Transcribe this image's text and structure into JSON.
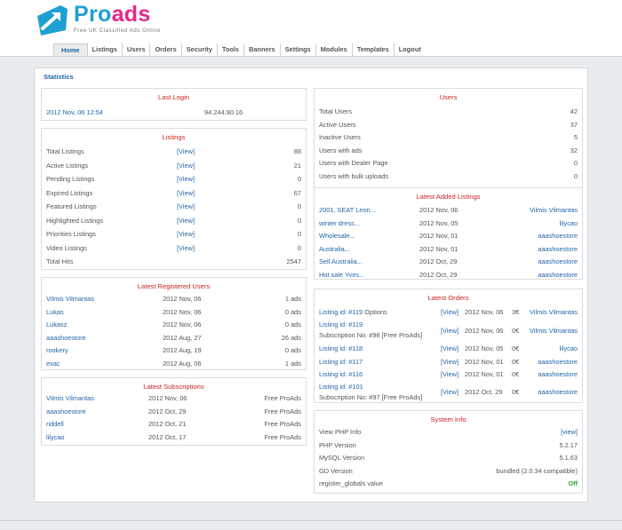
{
  "brand": {
    "name_part1": "Pro",
    "name_part2": "ads",
    "tagline": "Free UK Classified Ads Online"
  },
  "nav": [
    "Home",
    "Listings",
    "Users",
    "Orders",
    "Security",
    "Tools",
    "Banners",
    "Settings",
    "Modules",
    "Templates",
    "Logout"
  ],
  "page_title": "Statistics",
  "last_login": {
    "title": "Last Login",
    "date": "2012 Nov, 06 12:54",
    "ip": "94.244.90.16"
  },
  "listings": {
    "title": "Listings",
    "rows": [
      {
        "label": "Total Listings",
        "link": "[View]",
        "value": "88"
      },
      {
        "label": "Active Listings",
        "link": "[View]",
        "value": "21"
      },
      {
        "label": "Pending Listings",
        "link": "[View]",
        "value": "0"
      },
      {
        "label": "Expired Listings",
        "link": "[View]",
        "value": "67"
      },
      {
        "label": "Featured Listings",
        "link": "[View]",
        "value": "0"
      },
      {
        "label": "Highlighted Listings",
        "link": "[View]",
        "value": "0"
      },
      {
        "label": "Priorities Listings",
        "link": "[View]",
        "value": "0"
      },
      {
        "label": "Video Listings",
        "link": "[View]",
        "value": "0"
      }
    ],
    "total_hits_label": "Total Hits",
    "total_hits": "2547"
  },
  "latest_users": {
    "title": "Latest Registered Users",
    "rows": [
      {
        "name": "Vilmis Vilmantas",
        "date": "2012 Nov, 06",
        "ads": "1 ads"
      },
      {
        "name": "Lukas",
        "date": "2012 Nov, 06",
        "ads": "0 ads"
      },
      {
        "name": "Lukasz",
        "date": "2012 Nov, 06",
        "ads": "0 ads"
      },
      {
        "name": "aaashoestore",
        "date": "2012 Aug, 27",
        "ads": "26 ads"
      },
      {
        "name": "rookery",
        "date": "2012 Aug, 19",
        "ads": "0 ads"
      },
      {
        "name": "exac",
        "date": "2012 Aug, 06",
        "ads": "1 ads"
      }
    ]
  },
  "latest_subs": {
    "title": "Latest Subscriptions",
    "rows": [
      {
        "name": "Vilmis Vilmantas",
        "date": "2012 Nov, 06",
        "plan": "Free ProAds"
      },
      {
        "name": "aaashoestore",
        "date": "2012 Oct, 29",
        "plan": "Free ProAds"
      },
      {
        "name": "riddell",
        "date": "2012 Oct, 21",
        "plan": "Free ProAds"
      },
      {
        "name": "lilycao",
        "date": "2012 Oct, 17",
        "plan": "Free ProAds"
      }
    ]
  },
  "users": {
    "title": "Users",
    "rows": [
      {
        "label": "Total Users",
        "value": "42"
      },
      {
        "label": "Active Users",
        "value": "37"
      },
      {
        "label": "Inactive Users",
        "value": "5"
      },
      {
        "label": "Users with ads",
        "value": "32"
      },
      {
        "label": "Users with Dealer Page",
        "value": "0"
      },
      {
        "label": "Users with bulk uploads",
        "value": "0"
      }
    ]
  },
  "latest_listings": {
    "title": "Latest Added Listings",
    "rows": [
      {
        "title": "2001, SEAT Leon...",
        "date": "2012 Nov, 06",
        "user": "Vilmis Vilmantas"
      },
      {
        "title": "winter dress...",
        "date": "2012 Nov, 05",
        "user": "lilycao"
      },
      {
        "title": "Wholesale...",
        "date": "2012 Nov, 01",
        "user": "aaashoestore"
      },
      {
        "title": "Australia...",
        "date": "2012 Nov, 01",
        "user": "aaashoestore"
      },
      {
        "title": "Sell Australia...",
        "date": "2012 Oct, 29",
        "user": "aaashoestore"
      },
      {
        "title": "Hot sale Yves...",
        "date": "2012 Oct, 29",
        "user": "aaashoestore"
      }
    ]
  },
  "latest_orders": {
    "title": "Latest Orders",
    "rows": [
      {
        "id_label": "Listing id: #119",
        "extra": " Options",
        "sub": "",
        "view": "[View]",
        "date": "2012 Nov, 06",
        "amt": "3€",
        "user": "Vilmis Vilmantas"
      },
      {
        "id_label": "Listing id: #119",
        "extra": "",
        "sub": "Subscription No: #98 [Free ProAds]",
        "view": "[View]",
        "date": "2012 Nov, 06",
        "amt": "0€",
        "user": "Vilmis Vilmantas"
      },
      {
        "id_label": "Listing id: #118",
        "extra": "",
        "sub": "",
        "view": "[View]",
        "date": "2012 Nov, 05",
        "amt": "0€",
        "user": "lilycao"
      },
      {
        "id_label": "Listing id: #117",
        "extra": "",
        "sub": "",
        "view": "[View]",
        "date": "2012 Nov, 01",
        "amt": "0€",
        "user": "aaashoestore"
      },
      {
        "id_label": "Listing id: #116",
        "extra": "",
        "sub": "",
        "view": "[View]",
        "date": "2012 Nov, 01",
        "amt": "0€",
        "user": "aaashoestore"
      },
      {
        "id_label": "Listing id: #101",
        "extra": "",
        "sub": "Subscription No: #97 [Free ProAds]",
        "view": "[View]",
        "date": "2012 Oct, 29",
        "amt": "0€",
        "user": "aaashoestore"
      }
    ]
  },
  "system_info": {
    "title": "System Info",
    "rows": [
      {
        "label": "View PHP Info",
        "value": "[view]"
      },
      {
        "label": "PHP Version",
        "value": "5.2.17"
      },
      {
        "label": "MySQL Version",
        "value": "5.1.63"
      },
      {
        "label": "GD Version",
        "value": "bundled (2.0.34 compatible)"
      },
      {
        "label": "register_globals value",
        "value": "Off"
      }
    ]
  },
  "colors": {
    "brand_pink": "#e7278a",
    "brand_blue": "#1f9fd2",
    "link": "#2266aa",
    "panel_title": "#cc2222",
    "ok_green": "#33aa33"
  }
}
